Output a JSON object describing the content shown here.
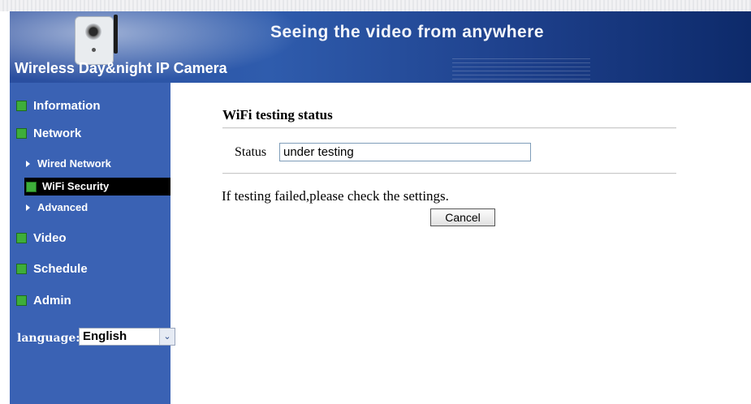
{
  "banner": {
    "headline": "Seeing the video from anywhere",
    "product": "Wireless Day&night IP Camera"
  },
  "sidebar": {
    "items": [
      {
        "label": "Information",
        "icon": "green-square-icon"
      },
      {
        "label": "Network",
        "icon": "green-square-icon"
      },
      {
        "label": "Wired Network",
        "icon": "triangle-bullet-icon"
      },
      {
        "label": "WiFi Security",
        "icon": "green-square-icon",
        "active": true
      },
      {
        "label": "Advanced",
        "icon": "triangle-bullet-icon"
      },
      {
        "label": "Video",
        "icon": "green-square-icon"
      },
      {
        "label": "Schedule",
        "icon": "green-square-icon"
      },
      {
        "label": "Admin",
        "icon": "green-square-icon"
      }
    ],
    "language_label": "language:",
    "language_value": "English"
  },
  "main": {
    "title": "WiFi testing status",
    "status_label": "Status",
    "status_value": "under testing",
    "note": "If testing failed,please check the settings.",
    "cancel_label": "Cancel"
  },
  "colors": {
    "sidebar_bg": "#3a62b4",
    "active_bg": "#000000",
    "icon_green": "#3eae3a",
    "banner_dark": "#0d2a6a"
  }
}
